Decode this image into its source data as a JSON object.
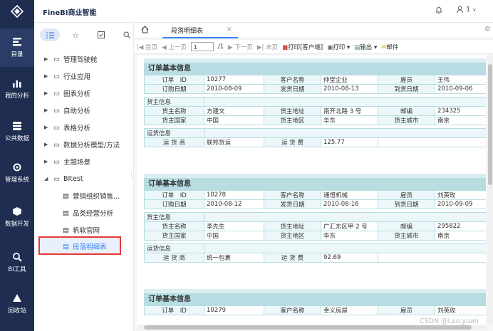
{
  "app": {
    "title": "FineBI商业智能",
    "user_label": "1"
  },
  "leftnav": [
    {
      "label": "目录",
      "icon": "catalog-icon"
    },
    {
      "label": "我的分析",
      "icon": "analysis-icon"
    },
    {
      "label": "公共数据",
      "icon": "database-icon"
    },
    {
      "label": "管理系统",
      "icon": "settings-icon"
    },
    {
      "label": "数据开发",
      "icon": "cube-icon"
    },
    {
      "label": "BI工具",
      "icon": "tool-icon"
    },
    {
      "label": "回收站",
      "icon": "recycle-icon"
    }
  ],
  "tree": {
    "folders": [
      "管理驾驶舱",
      "行业应用",
      "图表分析",
      "自助分析",
      "表格分析",
      "数据分析模型/方法",
      "主题场景",
      "BItest"
    ],
    "children": [
      "营销组织销售...",
      "品类经营分析",
      "帆软官网",
      "段落明细表"
    ]
  },
  "tabs": {
    "doc_title": "段落明细表",
    "close": "×",
    "more": "⊙"
  },
  "toolbar": {
    "first": "首页",
    "prev": "上一页",
    "page_value": "1",
    "total": "/1",
    "next": "下一页",
    "last": "末页",
    "print_client": "打印[客户端]",
    "print": "打印",
    "export": "输出",
    "mail": "邮件"
  },
  "report": {
    "band_title": "订单基本信息",
    "labels": {
      "order_id": "订单　ID",
      "customer": "客户名称",
      "employee": "雇员",
      "order_date": "订购日期",
      "ship_date": "发货日期",
      "arrive_date": "到货日期",
      "shipper_info": "货主信息",
      "shipper_name": "货主名称",
      "shipper_addr": "货主地址",
      "postcode": "邮编",
      "shipper_country": "货主国家",
      "shipper_region": "货主地区",
      "shipper_city": "货主城市",
      "transport_info": "运货信息",
      "carrier": "运 货 商",
      "freight": "运 货 费"
    },
    "orders": [
      {
        "id": "10277",
        "customer": "仲堂企业",
        "employee": "王伟",
        "order_date": "2010-08-09",
        "ship_date": "2010-08-13",
        "arrive_date": "2010-09-06",
        "shipper_name": "方建文",
        "shipper_addr": "南开北路 3 号",
        "postcode": "234325",
        "country": "中国",
        "region": "华东",
        "city": "南京",
        "carrier": "联邦货运",
        "freight": "125.77"
      },
      {
        "id": "10278",
        "customer": "通恒机械",
        "employee": "刘英玫",
        "order_date": "2010-08-12",
        "ship_date": "2010-08-16",
        "arrive_date": "2010-09-09",
        "shipper_name": "李先生",
        "shipper_addr": "广汇东区甲 2 号",
        "postcode": "295822",
        "country": "中国",
        "region": "华东",
        "city": "南京",
        "carrier": "统一包裹",
        "freight": "92.69"
      },
      {
        "id": "10279",
        "customer": "幸义房屋",
        "employee": "刘英玫"
      }
    ]
  },
  "watermark": "CSDN @Lao.yuan"
}
